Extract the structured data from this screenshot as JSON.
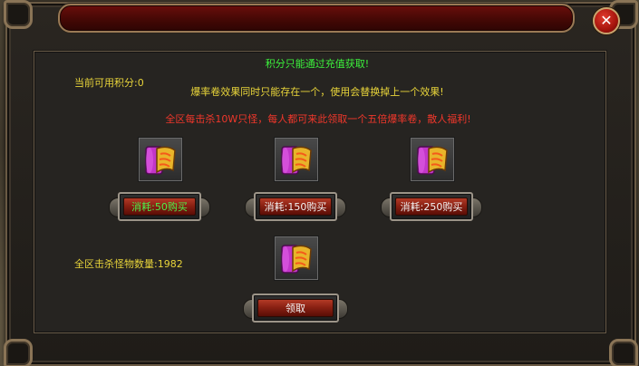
{
  "window": {
    "title": "",
    "close_icon": "close-icon",
    "close_glyph": "✕"
  },
  "notice": {
    "recharge_only": "积分只能通过充值获取!",
    "available_points": "当前可用积分:0",
    "scroll_effect": "爆率卷效果同时只能存在一个，使用会替换掉上一个效果!",
    "kill_reward": "全区每击杀10W只怪，每人都可来此领取一个五倍爆率卷，散人福利!"
  },
  "items": [
    {
      "icon": "scroll-icon",
      "button_label": "消耗:50购买"
    },
    {
      "icon": "scroll-icon",
      "button_label": "消耗:150购买"
    },
    {
      "icon": "scroll-icon",
      "button_label": "消耗:250购买"
    }
  ],
  "kill_count": "全区击杀怪物数量:1982",
  "claim": {
    "icon": "scroll-icon",
    "button_label": "领取"
  },
  "colors": {
    "green": "#3cf23c",
    "yellow": "#e8d43a",
    "red": "#f0372b",
    "button_red": "#8a2113"
  }
}
